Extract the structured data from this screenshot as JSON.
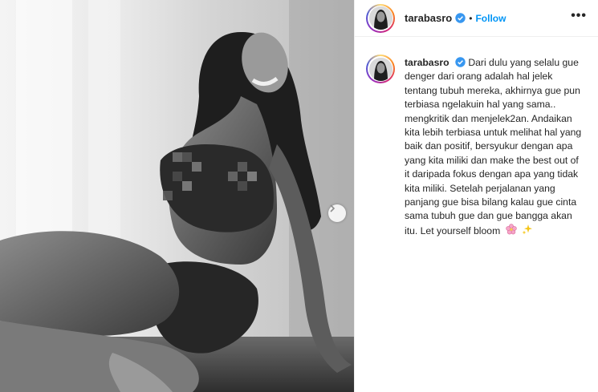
{
  "post": {
    "username": "tarabasro",
    "follow_label": "Follow",
    "separator": "•",
    "more_label": "•••",
    "caption_text": "Dari dulu yang selalu gue denger dari orang adalah hal jelek tentang tubuh mereka, akhirnya gue pun terbiasa ngelakuin hal yang sama.. mengkritik dan menjelek2an. Andaikan kita lebih terbiasa untuk melihat hal yang baik dan positif, bersyukur dengan apa yang kita miliki dan make the best out of it daripada fokus dengan apa yang tidak kita miliki. Setelah perjalanan yang panjang gue bisa bilang kalau gue cinta sama tubuh gue dan gue bangga akan itu. Let yourself bloom",
    "caption_emojis": [
      "cherry-blossom-icon",
      "sparkles-icon"
    ]
  },
  "colors": {
    "follow_blue": "#0095f6",
    "verified_blue": "#3897f0",
    "text": "#262626"
  }
}
